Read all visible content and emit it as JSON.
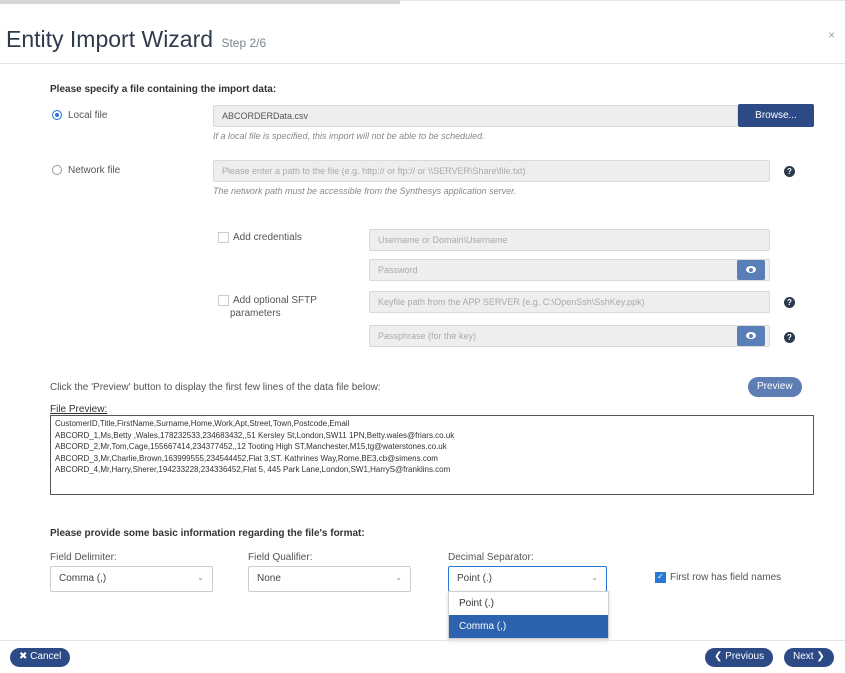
{
  "header": {
    "title": "Entity Import Wizard",
    "step": "Step 2/6",
    "close_glyph": "×"
  },
  "file_section": {
    "prompt": "Please specify a file containing the import data:",
    "local_file_label": "Local file",
    "local_file_value": "ABCORDERData.csv",
    "browse_label": "Browse...",
    "local_file_hint": "If a local file is specified, this import will not be able to be scheduled.",
    "network_file_label": "Network file",
    "network_file_placeholder": "Please enter a path to the file (e.g. http:// or ftp:// or \\\\SERVER\\Share\\file.txt)",
    "network_file_hint": "The network path must be accessible from the Synthesys application server.",
    "add_credentials_label": "Add credentials",
    "username_placeholder": "Username or Domain\\Username",
    "password_placeholder": "Password",
    "add_sftp_label_line1": "Add optional SFTP",
    "add_sftp_label_line2": "parameters",
    "keyfile_placeholder": "Keyfile path from the APP SERVER (e.g. C:\\OpenSsh\\SshKey.ppk)",
    "passphrase_placeholder": "Passphrase (for the key)"
  },
  "preview_section": {
    "instruction": "Click the 'Preview' button to display the first few lines of the data file below:",
    "preview_button": "Preview",
    "file_preview_label": "File Preview:",
    "lines": [
      "CustomerID,Title,FirstName,Surname,Home,Work,Apt,Street,Town,Postcode,Email",
      "ABCORD_1,Ms,Betty ,Wales,178232533,234683432,,51 Kersley St,London,SW11 1PN,Betty.wales@friars.co.uk",
      "ABCORD_2,Mr,Tom,Cage,155667414,234377452,,12 Tooting High ST,Manchester,M15,tg@waterstones.co.uk",
      "ABCORD_3,Mr,Charlie,Brown,163999555,234544452,Flat 3,ST. Kathrines Way,Rome,BE3,cb@simens.com",
      "ABCORD_4,Mr,Harry,Sherer,194233228,234336452,Flat 5, 445 Park Lane,London,SW1,HarryS@franklins.com"
    ]
  },
  "format_section": {
    "prompt": "Please provide some basic information regarding the file's format:",
    "field_delimiter_label": "Field Delimiter:",
    "field_delimiter_value": "Comma (,)",
    "field_qualifier_label": "Field Qualifier:",
    "field_qualifier_value": "None",
    "decimal_separator_label": "Decimal Separator:",
    "decimal_separator_value": "Point (.)",
    "decimal_options": [
      "Point (.)",
      "Comma (,)"
    ],
    "first_row_label": "First row has field names",
    "caret": "⌄"
  },
  "footer": {
    "cancel_label": "✖ Cancel",
    "previous_label": "❮ Previous",
    "next_label": "Next ❯"
  },
  "icons": {
    "help": "?"
  },
  "colors": {
    "primary": "#2c4a86",
    "selected_option": "#2c62ae",
    "radio_on": "#2a78d6"
  }
}
